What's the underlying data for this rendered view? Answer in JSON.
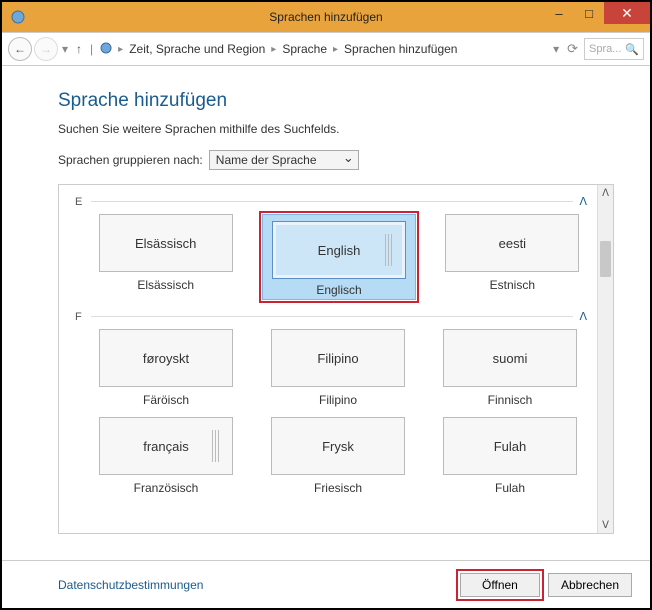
{
  "window": {
    "title": "Sprachen hinzufügen",
    "controls": {
      "minimize": "–",
      "maximize": "□",
      "close": "✕"
    }
  },
  "nav": {
    "breadcrumb": [
      "Zeit, Sprache und Region",
      "Sprache",
      "Sprachen hinzufügen"
    ],
    "search_placeholder": "Spra..."
  },
  "page": {
    "title": "Sprache hinzufügen",
    "instruction": "Suchen Sie weitere Sprachen mithilfe des Suchfelds.",
    "group_label": "Sprachen gruppieren nach:",
    "group_selected": "Name der Sprache"
  },
  "sections": [
    {
      "letter": "E",
      "items": [
        {
          "native": "Elsässisch",
          "caption": "Elsässisch",
          "selected": false,
          "expandable": false
        },
        {
          "native": "English",
          "caption": "Englisch",
          "selected": true,
          "expandable": true
        },
        {
          "native": "eesti",
          "caption": "Estnisch",
          "selected": false,
          "expandable": false
        }
      ]
    },
    {
      "letter": "F",
      "items": [
        {
          "native": "føroyskt",
          "caption": "Färöisch",
          "selected": false,
          "expandable": false
        },
        {
          "native": "Filipino",
          "caption": "Filipino",
          "selected": false,
          "expandable": false
        },
        {
          "native": "suomi",
          "caption": "Finnisch",
          "selected": false,
          "expandable": false
        },
        {
          "native": "français",
          "caption": "Französisch",
          "selected": false,
          "expandable": true
        },
        {
          "native": "Frysk",
          "caption": "Friesisch",
          "selected": false,
          "expandable": false
        },
        {
          "native": "Fulah",
          "caption": "Fulah",
          "selected": false,
          "expandable": false
        }
      ]
    }
  ],
  "footer": {
    "privacy": "Datenschutzbestimmungen",
    "open": "Öffnen",
    "cancel": "Abbrechen"
  }
}
